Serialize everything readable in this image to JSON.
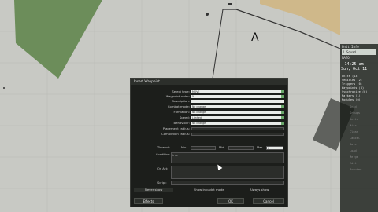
{
  "map": {
    "marker_label": "A"
  },
  "right_panel": {
    "header": "Unit Info",
    "selected_unit": "1 Squad",
    "group_label": "NATO",
    "clock": {
      "time": "14:25 am",
      "date": "Sun, Oct 11"
    },
    "groups": [
      "Units (13)",
      "Vehicles (2)",
      "Triggers (0)",
      "Waypoints (8)",
      "Synchronize (0)",
      "Markers (1)",
      "Modules (0)"
    ],
    "side_buttons": [
      "Grid",
      "Groups",
      "Units",
      "Misc",
      "Clear",
      "Cancel",
      "Save",
      "Load",
      "Merge",
      "Edit",
      "Preview"
    ]
  },
  "dialog": {
    "title": "Insert Waypoint",
    "fields": [
      {
        "label": "Select type:",
        "value": "MOVE"
      },
      {
        "label": "Waypoint order:",
        "value": "5"
      },
      {
        "label": "Description:",
        "value": ""
      },
      {
        "label": "Combat mode:",
        "value": "No change"
      },
      {
        "label": "Formation:",
        "value": "No change"
      },
      {
        "label": "Speed:",
        "value": "Limited"
      },
      {
        "label": "Behaviour:",
        "value": "No change"
      },
      {
        "label": "Placement radius:",
        "value": ""
      },
      {
        "label": "Completion radius:",
        "value": ""
      }
    ],
    "timeout": {
      "label": "Timeout:",
      "min_label": "Min",
      "mid_label": "Mid",
      "max_label": "Max",
      "max_value": "0"
    },
    "condition": {
      "label": "Condition:",
      "value": "true"
    },
    "on_act": {
      "label": "On Act:"
    },
    "script": {
      "label": "Script:"
    },
    "visibility": {
      "never": "Never show",
      "cadet": "Show in cadet mode",
      "always": "Always show"
    },
    "buttons": {
      "effects": "Effects",
      "ok": "OK",
      "cancel": "Cancel"
    }
  },
  "colors": {
    "map_bg": "#c8c9c4",
    "forest": "#6c8d5a",
    "beach": "#cfb88a",
    "dialog_bg": "#1c1e1b",
    "accent": "#6aa86a"
  }
}
